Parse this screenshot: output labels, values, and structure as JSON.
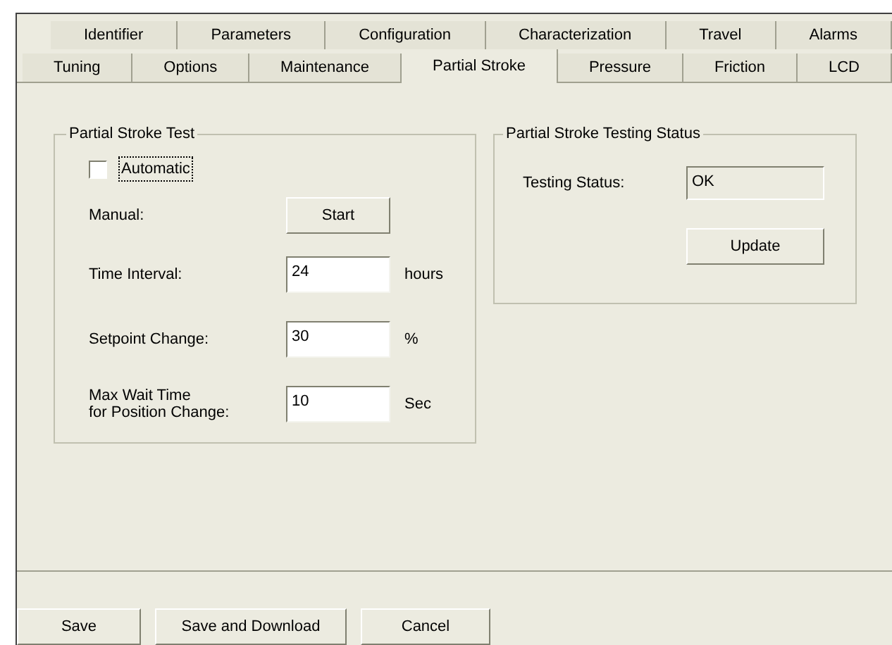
{
  "tab_rows": [
    [
      {
        "label": "Identifier",
        "selected": false
      },
      {
        "label": "Parameters",
        "selected": false
      },
      {
        "label": "Configuration",
        "selected": false
      },
      {
        "label": "Characterization",
        "selected": false
      },
      {
        "label": "Travel",
        "selected": false
      },
      {
        "label": "Alarms",
        "selected": false
      }
    ],
    [
      {
        "label": "Tuning",
        "selected": false
      },
      {
        "label": "Options",
        "selected": false
      },
      {
        "label": "Maintenance",
        "selected": false
      },
      {
        "label": "Partial Stroke",
        "selected": true
      },
      {
        "label": "Pressure",
        "selected": false
      },
      {
        "label": "Friction",
        "selected": false
      },
      {
        "label": "LCD",
        "selected": false
      }
    ]
  ],
  "partial_stroke_test": {
    "title": "Partial Stroke Test",
    "rows": [
      {
        "kind": "checkbox",
        "label": "Automatic",
        "checked": false
      },
      {
        "kind": "button",
        "label": "Manual:",
        "button": "Start"
      },
      {
        "kind": "field",
        "label": "Time Interval:",
        "value": "24",
        "unit": "hours"
      },
      {
        "kind": "field",
        "label": "Setpoint Change:",
        "value": "30",
        "unit": "%"
      },
      {
        "kind": "field",
        "label": "Max Wait Time\nfor Position Change:",
        "value": "10",
        "unit": "Sec"
      }
    ]
  },
  "testing_status": {
    "title": "Partial Stroke Testing Status",
    "label": "Testing Status:",
    "value": "OK",
    "button": "Update"
  },
  "buttons": [
    "Save",
    "Save and Download",
    "Cancel"
  ]
}
